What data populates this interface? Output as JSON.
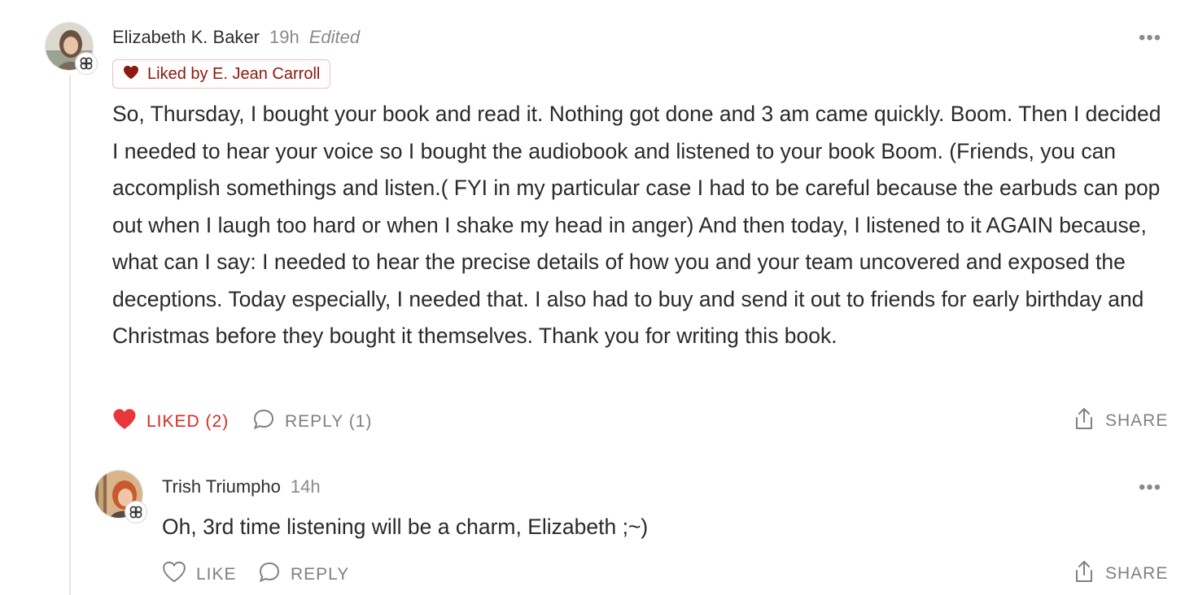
{
  "comment": {
    "author": "Elizabeth K. Baker",
    "time": "19h",
    "edited_label": "Edited",
    "liked_by": "Liked by E. Jean Carroll",
    "text": "So, Thursday, I bought your book and read it. Nothing got done and 3 am came quickly. Boom. Then I decided I needed to hear your voice so I bought the audiobook and listened to your book Boom. (Friends, you can accomplish somethings and listen.( FYI in my particular case I had to be careful because the earbuds can pop out when I laugh too hard or when I shake my head in anger) And then today, I listened to it AGAIN because, what can I say: I needed to hear the precise details of how you and your team uncovered and exposed the deceptions. Today especially, I needed that. I also had to buy and send it out to friends for early birthday and Christmas before they bought it themselves. Thank you for writing this book.",
    "more_label": "•••",
    "like_label": "LIKED (2)",
    "reply_label": "REPLY (1)",
    "share_label": "SHARE",
    "like_state": "liked",
    "icons": {
      "like": "heart-filled-icon",
      "reply": "speech-bubble-icon",
      "share": "share-icon",
      "badge": "clover-badge-icon"
    }
  },
  "reply": {
    "author": "Trish Triumpho",
    "time": "14h",
    "text": "Oh, 3rd time listening will be a charm, Elizabeth ;~)",
    "more_label": "•••",
    "like_label": "LIKE",
    "reply_label": "REPLY",
    "share_label": "SHARE",
    "like_state": "not-liked",
    "icons": {
      "like": "heart-outline-icon",
      "reply": "speech-bubble-icon",
      "share": "share-icon",
      "badge": "clover-badge-icon"
    }
  },
  "colors": {
    "liked_red": "#d62a20",
    "liked_by_text": "#8b1a10",
    "liked_by_border": "#f0c2bf",
    "muted_gray": "#808080"
  }
}
